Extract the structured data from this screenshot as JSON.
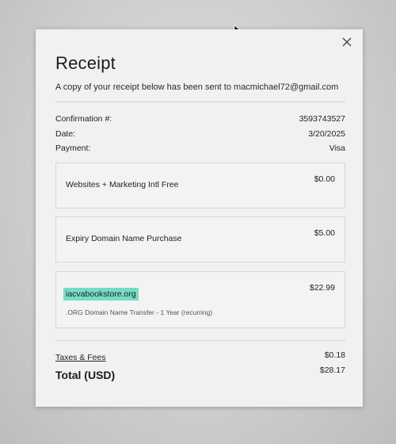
{
  "receipt": {
    "title": "Receipt",
    "subtitle": "A copy of your receipt below has been sent to macmichael72@gmail.com",
    "confirmation_label": "Confirmation #:",
    "confirmation_value": "3593743527",
    "date_label": "Date:",
    "date_value": "3/20/2025",
    "payment_label": "Payment:",
    "payment_value": "Visa"
  },
  "items": [
    {
      "name": "Websites + Marketing Intl Free",
      "price": "$0.00"
    },
    {
      "name": "Expiry Domain Name Purchase",
      "price": "$5.00"
    },
    {
      "name": "iacvabookstore.org",
      "price": "$22.99",
      "description": ".ORG Domain Name Transfer - 1 Year (recurring)"
    }
  ],
  "totals": {
    "taxes_label": "Taxes & Fees",
    "taxes_value": "$0.18",
    "total_label": "Total (USD)",
    "total_value": "$28.17"
  },
  "icons": {
    "close": "close-icon",
    "cursor": "mouse-cursor-icon"
  },
  "colors": {
    "highlight": "#76dcc6"
  }
}
